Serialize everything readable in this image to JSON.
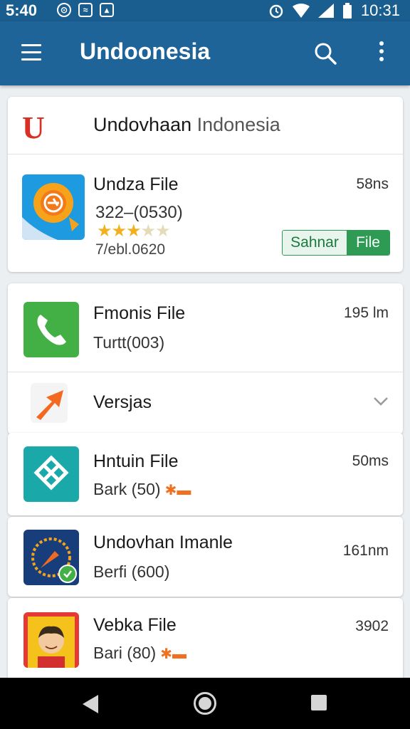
{
  "status_bar": {
    "time_left": "5:40",
    "time_right": "10:31",
    "icons": [
      "notification-icon",
      "signal-stats-icon",
      "image-icon",
      "alarm-icon",
      "wifi-icon",
      "cell-signal-icon",
      "battery-icon"
    ]
  },
  "app_bar": {
    "title": "Undoonesia",
    "icons": [
      "menu-icon",
      "search-icon",
      "more-vert-icon"
    ]
  },
  "card1": {
    "header": {
      "logo_letter": "U",
      "title_main": "Undovhaan",
      "title_light": " Indonesia"
    },
    "item": {
      "name": "Undza File",
      "code": "322–(0530)",
      "size": "58ns",
      "rating": 3,
      "rating_max": 5,
      "date": "7/ebl.0620",
      "button_left": "Sahnar",
      "button_right": "File"
    }
  },
  "list": [
    {
      "name": "Fmonis File",
      "sub": "Turtt(003)",
      "size": "195 lm",
      "icon": "phone-icon"
    },
    {
      "name": "Versjas",
      "icon": "arrow-icon",
      "expandable": true
    },
    {
      "name": "Hntuin File",
      "sub": "Bark (50)",
      "size": "50ms",
      "icon": "network-icon",
      "tag": "tag-icon"
    },
    {
      "name": "Undovhan Imanle",
      "sub": "Berfi (600)",
      "size": "161nm",
      "icon": "compass-icon"
    },
    {
      "name": "Vebka File",
      "sub": "Bari (80)",
      "size": "3902",
      "icon": "avatar-icon",
      "tag": "tag-icon"
    }
  ],
  "colors": {
    "app_bar": "#1f6498",
    "status_bar": "#1a5d8f",
    "accent_green": "#2e9b54",
    "star": "#f2b01e",
    "logo_red": "#d93025"
  },
  "nav_bar": {
    "icons": [
      "back-icon",
      "home-icon",
      "recents-icon"
    ]
  }
}
